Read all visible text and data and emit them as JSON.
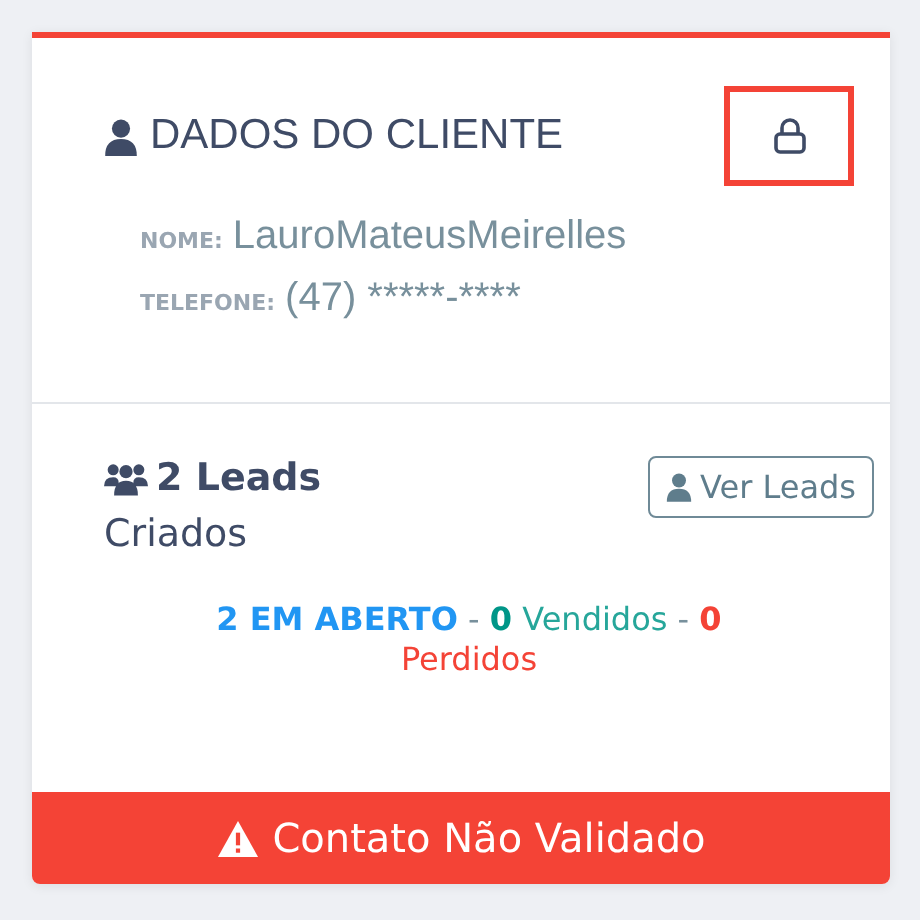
{
  "client": {
    "title": "DADOS DO CLIENTE",
    "fields": [
      {
        "label": "NOME:",
        "value": "LauroMateusMeirelles"
      },
      {
        "label": "TELEFONE:",
        "value": "(47) *****-****"
      }
    ]
  },
  "leads": {
    "count": "2 Leads",
    "caption": "Criados",
    "button": "Ver Leads",
    "summary": [
      {
        "kind": "open",
        "text": "2 EM ABERTO"
      },
      {
        "kind": "sep",
        "text": "-"
      },
      {
        "kind": "sold_count",
        "text": "0"
      },
      {
        "kind": "sold",
        "text": "Vendidos"
      },
      {
        "kind": "sep",
        "text": "-"
      },
      {
        "kind": "lost_count",
        "text": "0"
      },
      {
        "kind": "lost",
        "text": "Perdidos"
      }
    ]
  },
  "alert": {
    "text": "Contato Não Validado"
  }
}
